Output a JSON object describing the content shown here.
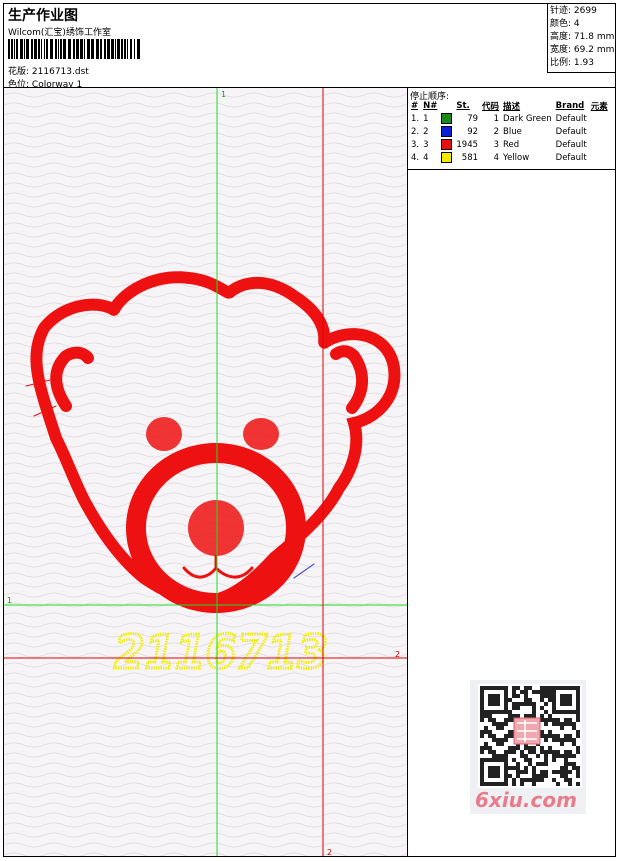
{
  "header": {
    "title": "生产作业图",
    "studio": "Wilcom(汇宝)绣饰工作室",
    "design_label": "花版:",
    "design_value": "2116713.dst",
    "colorway_label": "色位:",
    "colorway_value": "Colorway 1"
  },
  "stats": [
    {
      "label": "针迹:",
      "value": "2699"
    },
    {
      "label": "颜色:",
      "value": "4"
    },
    {
      "label": "高度:",
      "value": "71.8 mm"
    },
    {
      "label": "宽度:",
      "value": "69.2 mm"
    },
    {
      "label": "比例:",
      "value": "1.93"
    }
  ],
  "stop_sequence": {
    "title": "停止顺序:",
    "columns": {
      "index": "#",
      "number": "N#",
      "stitches": "St.",
      "code": "代码",
      "description": "描述",
      "brand": "Brand",
      "element": "元素"
    },
    "rows": [
      {
        "index": "1.",
        "number": "1",
        "color": "#1a8a1a",
        "stitches": "79",
        "code": "1",
        "description": "Dark Green",
        "brand": "Default"
      },
      {
        "index": "2.",
        "number": "2",
        "color": "#0b1fd8",
        "stitches": "92",
        "code": "2",
        "description": "Blue",
        "brand": "Default"
      },
      {
        "index": "3.",
        "number": "3",
        "color": "#e81010",
        "stitches": "1945",
        "code": "3",
        "description": "Red",
        "brand": "Default"
      },
      {
        "index": "4.",
        "number": "4",
        "color": "#f5e800",
        "stitches": "581",
        "code": "4",
        "description": "Yellow",
        "brand": "Default"
      }
    ]
  },
  "canvas": {
    "guide_labels": {
      "green_v": "1",
      "green_h": "1",
      "red_h": "2",
      "red_v": "2"
    },
    "embroidery_text": "2116713",
    "colors": {
      "green_guide": "#22dd22",
      "red_guide": "#e00000",
      "stitch_red": "#ee1111",
      "stitch_yellow": "#f2ee10"
    }
  },
  "watermark": {
    "text": "6xiu.com"
  }
}
